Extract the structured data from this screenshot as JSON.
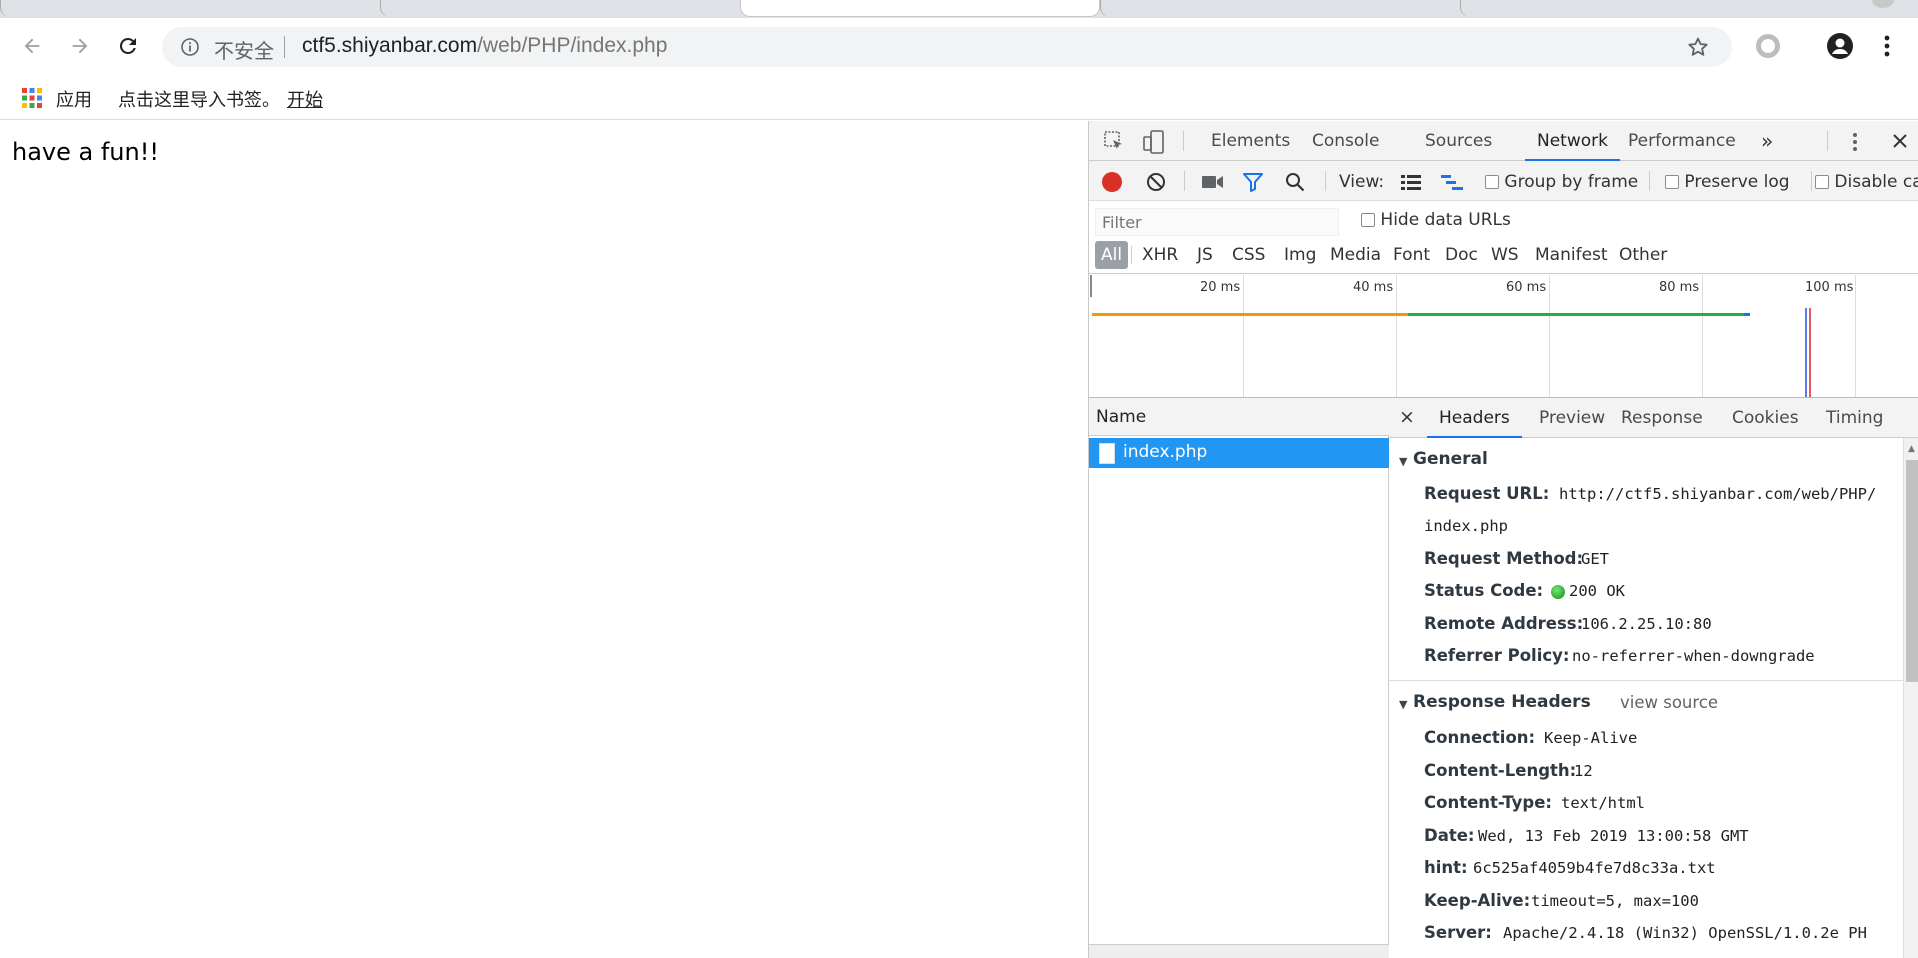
{
  "tabs": [
    {
      "title": "",
      "active": false
    },
    {
      "title": "",
      "active": false
    },
    {
      "title": "",
      "active": true
    },
    {
      "title": "",
      "active": false
    }
  ],
  "toolbar": {
    "security_label": "不安全",
    "url_host": "ctf5.shiyanbar.com",
    "url_path": "/web/PHP/index.php"
  },
  "bookmarks": {
    "apps_label": "应用",
    "import_text": "点击这里导入书签。",
    "start_link": "开始"
  },
  "page": {
    "body_text": "have a fun!!"
  },
  "devtools": {
    "tabs": [
      "Elements",
      "Console",
      "Sources",
      "Network",
      "Performance"
    ],
    "active_tab": "Network",
    "network_toolbar": {
      "view_label": "View:",
      "group_by_frame": "Group by frame",
      "preserve_log": "Preserve log",
      "disable_cache": "Disable ca"
    },
    "filter": {
      "placeholder": "Filter",
      "hide_data_urls": "Hide data URLs",
      "types": [
        "All",
        "XHR",
        "JS",
        "CSS",
        "Img",
        "Media",
        "Font",
        "Doc",
        "WS",
        "Manifest",
        "Other"
      ]
    },
    "timeline": {
      "ticks": [
        "20 ms",
        "40 ms",
        "60 ms",
        "80 ms",
        "100 ms"
      ]
    },
    "requests": {
      "column": "Name",
      "items": [
        "index.php"
      ]
    },
    "detail": {
      "tabs": [
        "Headers",
        "Preview",
        "Response",
        "Cookies",
        "Timing"
      ],
      "active_tab": "Headers",
      "general": {
        "title": "General",
        "request_url_key": "Request URL:",
        "request_url_line1": "http://ctf5.shiyanbar.com/web/PHP/",
        "request_url_line2": "index.php",
        "method_key": "Request Method:",
        "method": "GET",
        "status_key": "Status Code:",
        "status": "200 OK",
        "remote_key": "Remote Address:",
        "remote": "106.2.25.10:80",
        "referrer_key": "Referrer Policy:",
        "referrer": "no-referrer-when-downgrade"
      },
      "response_headers": {
        "title": "Response Headers",
        "view_source": "view source",
        "items": [
          {
            "key": "Connection:",
            "value": "Keep-Alive"
          },
          {
            "key": "Content-Length:",
            "value": "12"
          },
          {
            "key": "Content-Type:",
            "value": "text/html"
          },
          {
            "key": "Date:",
            "value": "Wed, 13 Feb 2019 13:00:58 GMT"
          },
          {
            "key": "hint:",
            "value": "6c525af4059b4fe7d8c33a.txt"
          },
          {
            "key": "Keep-Alive:",
            "value": "timeout=5, max=100"
          },
          {
            "key": "Server:",
            "value": "Apache/2.4.18 (Win32) OpenSSL/1.0.2e PH"
          }
        ]
      }
    },
    "colors": {
      "selected_row": "#2196f3",
      "record_red": "#d93025",
      "active_blue": "#1a73e8",
      "timeline_orange": "#f29900",
      "timeline_green": "#1fb141",
      "status_green": "#0a8f08"
    }
  }
}
